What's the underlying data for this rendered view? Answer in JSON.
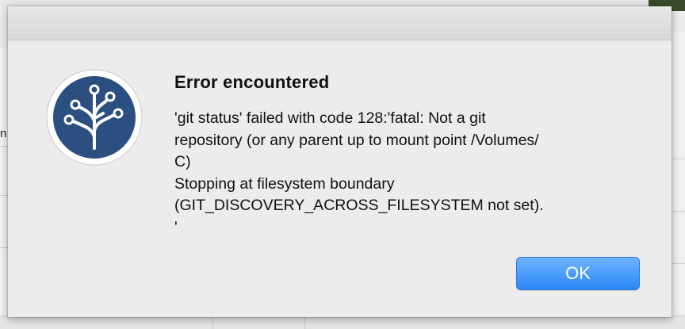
{
  "background": {
    "left_edge_char": "n"
  },
  "alert": {
    "icon": "sourcetree-icon",
    "title": "Error encountered",
    "message": "'git status' failed with code 128:'fatal: Not a git\nrepository (or any parent up to mount point /Volumes/\nC)\nStopping at filesystem boundary\n(GIT_DISCOVERY_ACROSS_FILESYSTEM not set).\n'",
    "ok_label": "OK"
  },
  "colors": {
    "icon_blue": "#2c4f82",
    "button_blue": "#2b88f7",
    "sheet_bg": "#ececec"
  }
}
